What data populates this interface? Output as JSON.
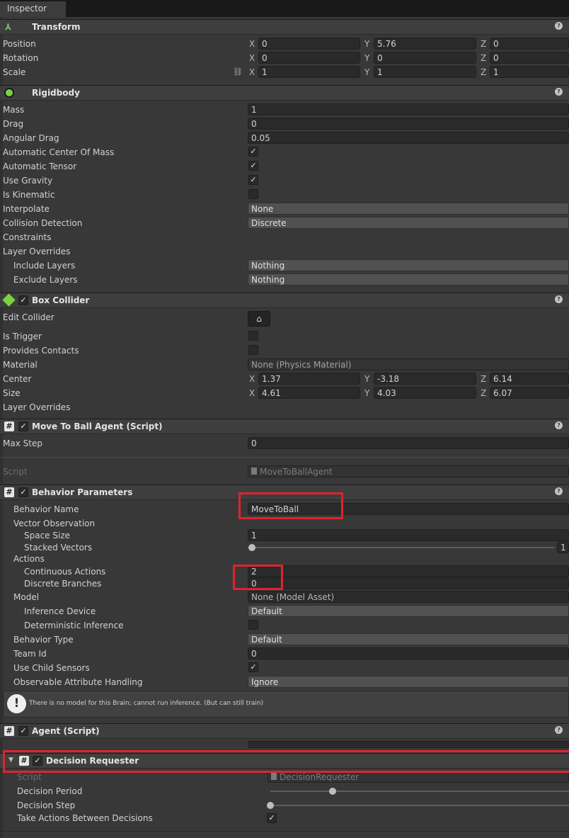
{
  "tab": {
    "label": "Inspector"
  },
  "colors": {
    "highlight": "#e0232f",
    "panel": "#383838",
    "header": "#3e3e3e",
    "field": "#2a2a2a"
  },
  "transform": {
    "title": "Transform",
    "position": {
      "label": "Position",
      "x": "0",
      "y": "5.76",
      "z": "0"
    },
    "rotation": {
      "label": "Rotation",
      "x": "0",
      "y": "0",
      "z": "0"
    },
    "scale": {
      "label": "Scale",
      "x": "1",
      "y": "1",
      "z": "1"
    }
  },
  "axes": {
    "x": "X",
    "y": "Y",
    "z": "Z"
  },
  "rigidbody": {
    "title": "Rigidbody",
    "mass": {
      "label": "Mass",
      "value": "1"
    },
    "drag": {
      "label": "Drag",
      "value": "0"
    },
    "angular_drag": {
      "label": "Angular Drag",
      "value": "0.05"
    },
    "auto_com": {
      "label": "Automatic Center Of Mass",
      "checked": true
    },
    "auto_tensor": {
      "label": "Automatic Tensor",
      "checked": true
    },
    "use_gravity": {
      "label": "Use Gravity",
      "checked": true
    },
    "is_kinematic": {
      "label": "Is Kinematic",
      "checked": false
    },
    "interpolate": {
      "label": "Interpolate",
      "value": "None"
    },
    "collision": {
      "label": "Collision Detection",
      "value": "Discrete"
    },
    "constraints": {
      "label": "Constraints"
    },
    "layer_overrides": {
      "label": "Layer Overrides"
    },
    "include_layers": {
      "label": "Include Layers",
      "value": "Nothing"
    },
    "exclude_layers": {
      "label": "Exclude Layers",
      "value": "Nothing"
    }
  },
  "box_collider": {
    "title": "Box Collider",
    "edit": {
      "label": "Edit Collider",
      "icon": "edit-collider-icon"
    },
    "is_trigger": {
      "label": "Is Trigger"
    },
    "provides_contacts": {
      "label": "Provides Contacts"
    },
    "material": {
      "label": "Material",
      "value": "None (Physics Material)"
    },
    "center": {
      "label": "Center",
      "x": "1.37",
      "y": "-3.18",
      "z": "6.14"
    },
    "size": {
      "label": "Size",
      "x": "4.61",
      "y": "4.03",
      "z": "6.07"
    },
    "layer_overrides": {
      "label": "Layer Overrides"
    }
  },
  "move_agent": {
    "title": "Move To Ball Agent (Script)",
    "max_step": {
      "label": "Max Step",
      "value": "0"
    },
    "script": {
      "label": "Script",
      "value": "MoveToBallAgent"
    }
  },
  "behavior": {
    "title": "Behavior Parameters",
    "name": {
      "label": "Behavior Name",
      "value": "MoveToBall"
    },
    "vector_obs": {
      "label": "Vector Observation"
    },
    "space_size": {
      "label": "Space Size",
      "value": "1"
    },
    "stacked": {
      "label": "Stacked Vectors",
      "value": "1"
    },
    "actions": {
      "label": "Actions"
    },
    "continuous": {
      "label": "Continuous Actions",
      "value": "2"
    },
    "discrete": {
      "label": "Discrete Branches",
      "value": "0"
    },
    "model": {
      "label": "Model",
      "value": "None (Model Asset)"
    },
    "inference_device": {
      "label": "Inference Device",
      "value": "Default"
    },
    "deterministic": {
      "label": "Deterministic Inference"
    },
    "behavior_type": {
      "label": "Behavior Type",
      "value": "Default"
    },
    "team_id": {
      "label": "Team Id",
      "value": "0"
    },
    "child_sensors": {
      "label": "Use Child Sensors"
    },
    "observable": {
      "label": "Observable Attribute Handling",
      "value": "Ignore"
    },
    "warning": "There is no model for this Brain; cannot run inference. (But can still train)"
  },
  "agent": {
    "title": "Agent (Script)"
  },
  "decision": {
    "title": "Decision Requester",
    "script": {
      "label": "Script",
      "value": "DecisionRequester"
    },
    "period": {
      "label": "Decision Period"
    },
    "step": {
      "label": "Decision Step"
    },
    "take_actions": {
      "label": "Take Actions Between Decisions"
    }
  }
}
